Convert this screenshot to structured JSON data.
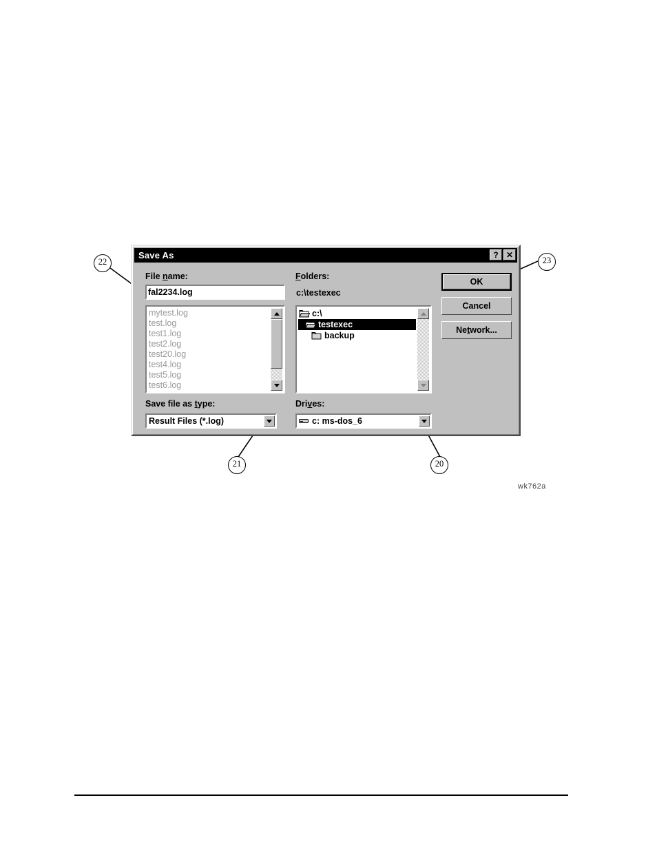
{
  "figure": {
    "id_label": "wk762a"
  },
  "dialog": {
    "title": "Save As",
    "title_buttons": [
      {
        "name": "help",
        "glyph": "?"
      },
      {
        "name": "close",
        "glyph": "✕"
      }
    ],
    "filename": {
      "label_before": "File ",
      "label_accel": "n",
      "label_after": "ame:",
      "value": "fal2234.log",
      "placeholder": ""
    },
    "file_list": {
      "items": [
        "mytest.log",
        "test.log",
        "test1.log",
        "test2.log",
        "test20.log",
        "test4.log",
        "test5.log",
        "test6.log"
      ]
    },
    "folders": {
      "label_accel": "F",
      "label_after": "olders:",
      "current_path": "c:\\testexec",
      "tree": [
        {
          "name": "c:\\",
          "indent": 0,
          "icon": "folder-open-icon",
          "selected": false
        },
        {
          "name": "testexec",
          "indent": 1,
          "icon": "folder-open-icon",
          "selected": true
        },
        {
          "name": "backup",
          "indent": 2,
          "icon": "folder-closed-icon",
          "selected": false
        }
      ]
    },
    "save_as_type": {
      "label_before": "Save file as ",
      "label_accel": "t",
      "label_after": "ype:",
      "value": "Result Files (*.log)"
    },
    "drives": {
      "label_before": "Dri",
      "label_accel": "v",
      "label_after": "es:",
      "value": "c: ms-dos_6",
      "icon": "drive-icon"
    },
    "buttons": [
      {
        "name": "ok",
        "label": "OK",
        "default": true
      },
      {
        "name": "cancel",
        "label": "Cancel",
        "default": false
      },
      {
        "name": "network",
        "label_before": "Ne",
        "label_accel": "t",
        "label_after": "work...",
        "label": "Network...",
        "default": false
      }
    ]
  },
  "callouts": [
    {
      "number": "22",
      "target": "file-name-field"
    },
    {
      "number": "23",
      "target": "ok-button"
    },
    {
      "number": "21",
      "target": "save-file-as-type-dropdown"
    },
    {
      "number": "20",
      "target": "drives-dropdown"
    }
  ],
  "colors": {
    "dialog_face": "#c0c0c0",
    "titlebar": "#000000",
    "field_bg": "#ffffff",
    "disabled_text": "#9a9a9a",
    "selection_bg": "#000000"
  }
}
